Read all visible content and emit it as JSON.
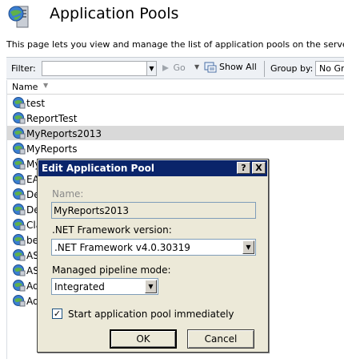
{
  "header": {
    "title": "Application Pools",
    "description": "This page lets you view and manage the list of application pools on the server."
  },
  "toolbar": {
    "filter_label": "Filter:",
    "filter_value": "",
    "go_label": "Go",
    "show_all_label": "Show All",
    "group_by_label": "Group by:",
    "group_by_value": "No Grou"
  },
  "list": {
    "column_header": "Name",
    "items": [
      {
        "label": "test"
      },
      {
        "label": "ReportTest"
      },
      {
        "label": "MyReports2013",
        "selected": true
      },
      {
        "label": "MyReports"
      },
      {
        "label": "My"
      },
      {
        "label": "EA"
      },
      {
        "label": "De"
      },
      {
        "label": "De"
      },
      {
        "label": "Cla"
      },
      {
        "label": "be"
      },
      {
        "label": "AS"
      },
      {
        "label": "AS"
      },
      {
        "label": "Ad"
      },
      {
        "label": "Ad"
      }
    ]
  },
  "dialog": {
    "title": "Edit Application Pool",
    "help_button": "?",
    "close_button": "X",
    "name_label": "Name:",
    "name_value": "MyReports2013",
    "framework_label": ".NET Framework version:",
    "framework_value": ".NET Framework v4.0.30319",
    "pipeline_label": "Managed pipeline mode:",
    "pipeline_value": "Integrated",
    "start_immediately_label": "Start application pool immediately",
    "start_immediately_checked": true,
    "ok_label": "OK",
    "cancel_label": "Cancel"
  },
  "colors": {
    "dialog_title_bar": "#0a246a",
    "selected_row": "#d9d9d9",
    "dialog_face": "#ece9d8"
  }
}
